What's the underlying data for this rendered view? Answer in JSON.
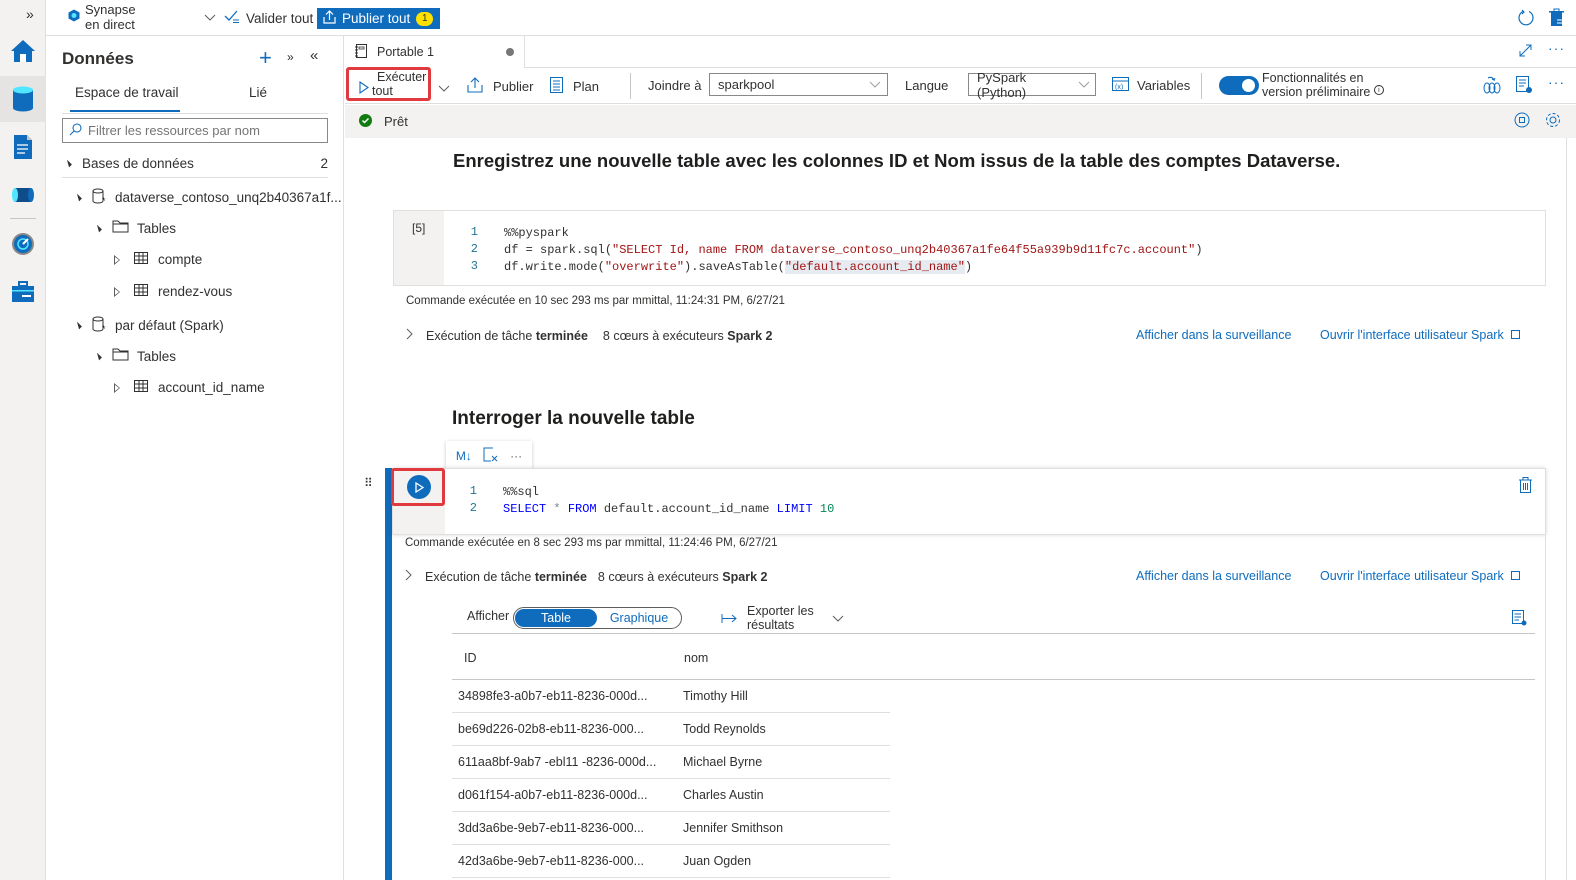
{
  "app": {
    "workspace_mode_line1": "Synapse",
    "workspace_mode_line2": "en direct",
    "validate_all": "Valider tout",
    "publish_all": "Publier tout",
    "publish_count": "1"
  },
  "rail": {
    "icons": [
      "home-icon",
      "data-icon",
      "develop-icon",
      "integrate-icon",
      "monitor-icon",
      "manage-icon"
    ]
  },
  "panel": {
    "title": "Données",
    "tabs": [
      {
        "label": "Espace de travail",
        "active": true
      },
      {
        "label": "Lié",
        "active": false
      }
    ],
    "filter_placeholder": "Filtrer les ressources par nom",
    "tree": {
      "section_label": "Bases de données",
      "section_count": "2",
      "databases": [
        {
          "name": "dataverse_contoso_unq2b40367a1f...",
          "folder": "Tables",
          "tables": [
            "compte",
            "rendez-vous"
          ]
        },
        {
          "name": "par défaut (Spark)",
          "folder": "Tables",
          "tables": [
            "account_id_name"
          ]
        }
      ]
    }
  },
  "notebook": {
    "tab_title": "Portable 1",
    "toolbar": {
      "run_all_line1": "Exécuter",
      "run_all_line2": "tout",
      "publish": "Publier",
      "plan": "Plan",
      "attach_label": "Joindre à",
      "attach_value": "sparkpool",
      "language_label": "Langue",
      "language_value": "PySpark (Python)",
      "variables": "Variables",
      "preview_line1": "Fonctionnalités en",
      "preview_line2": "version préliminaire",
      "preview_enabled": true
    },
    "status": "Prêt",
    "cells": [
      {
        "heading": "Enregistrez une nouvelle table avec les colonnes ID et Nom issus de la table des comptes Dataverse.",
        "exec_count": "[5]",
        "lines": [
          {
            "n": "1",
            "text": "%%pyspark"
          },
          {
            "n": "2",
            "pre": "df = spark.sql(",
            "str": "\"SELECT Id, name FROM dataverse_contoso_unq2b40367a1fe64f55a939b9d11fc7c.account\"",
            "post": ")"
          },
          {
            "n": "3",
            "pre": "df.write.mode(",
            "str": "\"overwrite\"",
            "mid": ").saveAsTable(",
            "str2": "\"default.account_id_name\"",
            "post": ")"
          }
        ],
        "meta": "Commande exécutée en 10 sec 293 ms par mmittal, 11:24:31 PM, 6/27/21",
        "job_prefix": "Exécution de tâche",
        "job_status": "terminée",
        "job_executors": "8 cœurs à exécuteurs",
        "job_spark": "Spark 2",
        "link_monitor": "Afficher dans la surveillance",
        "link_spark_ui": "Ouvrir l'interface utilisateur Spark"
      },
      {
        "heading": "Interroger la nouvelle table",
        "lines": [
          {
            "n": "1",
            "text": "%%sql"
          },
          {
            "n": "2",
            "kw1": "SELECT",
            "op": " * ",
            "kw2": "FROM",
            "ident": " default.account_id_name ",
            "kw3": "LIMIT",
            "num": " 10"
          }
        ],
        "meta": "Commande exécutée en 8 sec 293 ms par mmittal, 11:24:46 PM, 6/27/21",
        "job_prefix": "Exécution de tâche",
        "job_status": "terminée",
        "job_executors": "8 cœurs à exécuteurs",
        "job_spark": "Spark 2",
        "link_monitor": "Afficher dans la surveillance",
        "link_spark_ui": "Ouvrir l'interface utilisateur Spark",
        "cell_toolbar": {
          "markdown": "M↓"
        },
        "results": {
          "view_label": "Afficher",
          "view_table": "Table",
          "view_chart": "Graphique",
          "export_line1": "Exporter les",
          "export_line2": "résultats",
          "columns": [
            "ID",
            "nom"
          ],
          "rows": [
            [
              "34898fe3-a0b7-eb11-8236-000d...",
              "Timothy Hill"
            ],
            [
              "be69d226-02b8-eb11-8236-000...",
              "Todd Reynolds"
            ],
            [
              "611aa8bf-9ab7 -ebl11 -8236-000d...",
              "Michael Byrne"
            ],
            [
              "d061f154-a0b7-eb11-8236-000d...",
              "Charles Austin"
            ],
            [
              "3dd3a6be-9eb7-eb11-8236-000...",
              "Jennifer Smithson"
            ],
            [
              "42d3a6be-9eb7-eb11-8236-000...",
              "Juan Ogden"
            ]
          ]
        }
      }
    ]
  },
  "colors": {
    "accent": "#0f6cbd",
    "highlight_border": "#e03a3e",
    "ready": "#107c10"
  }
}
